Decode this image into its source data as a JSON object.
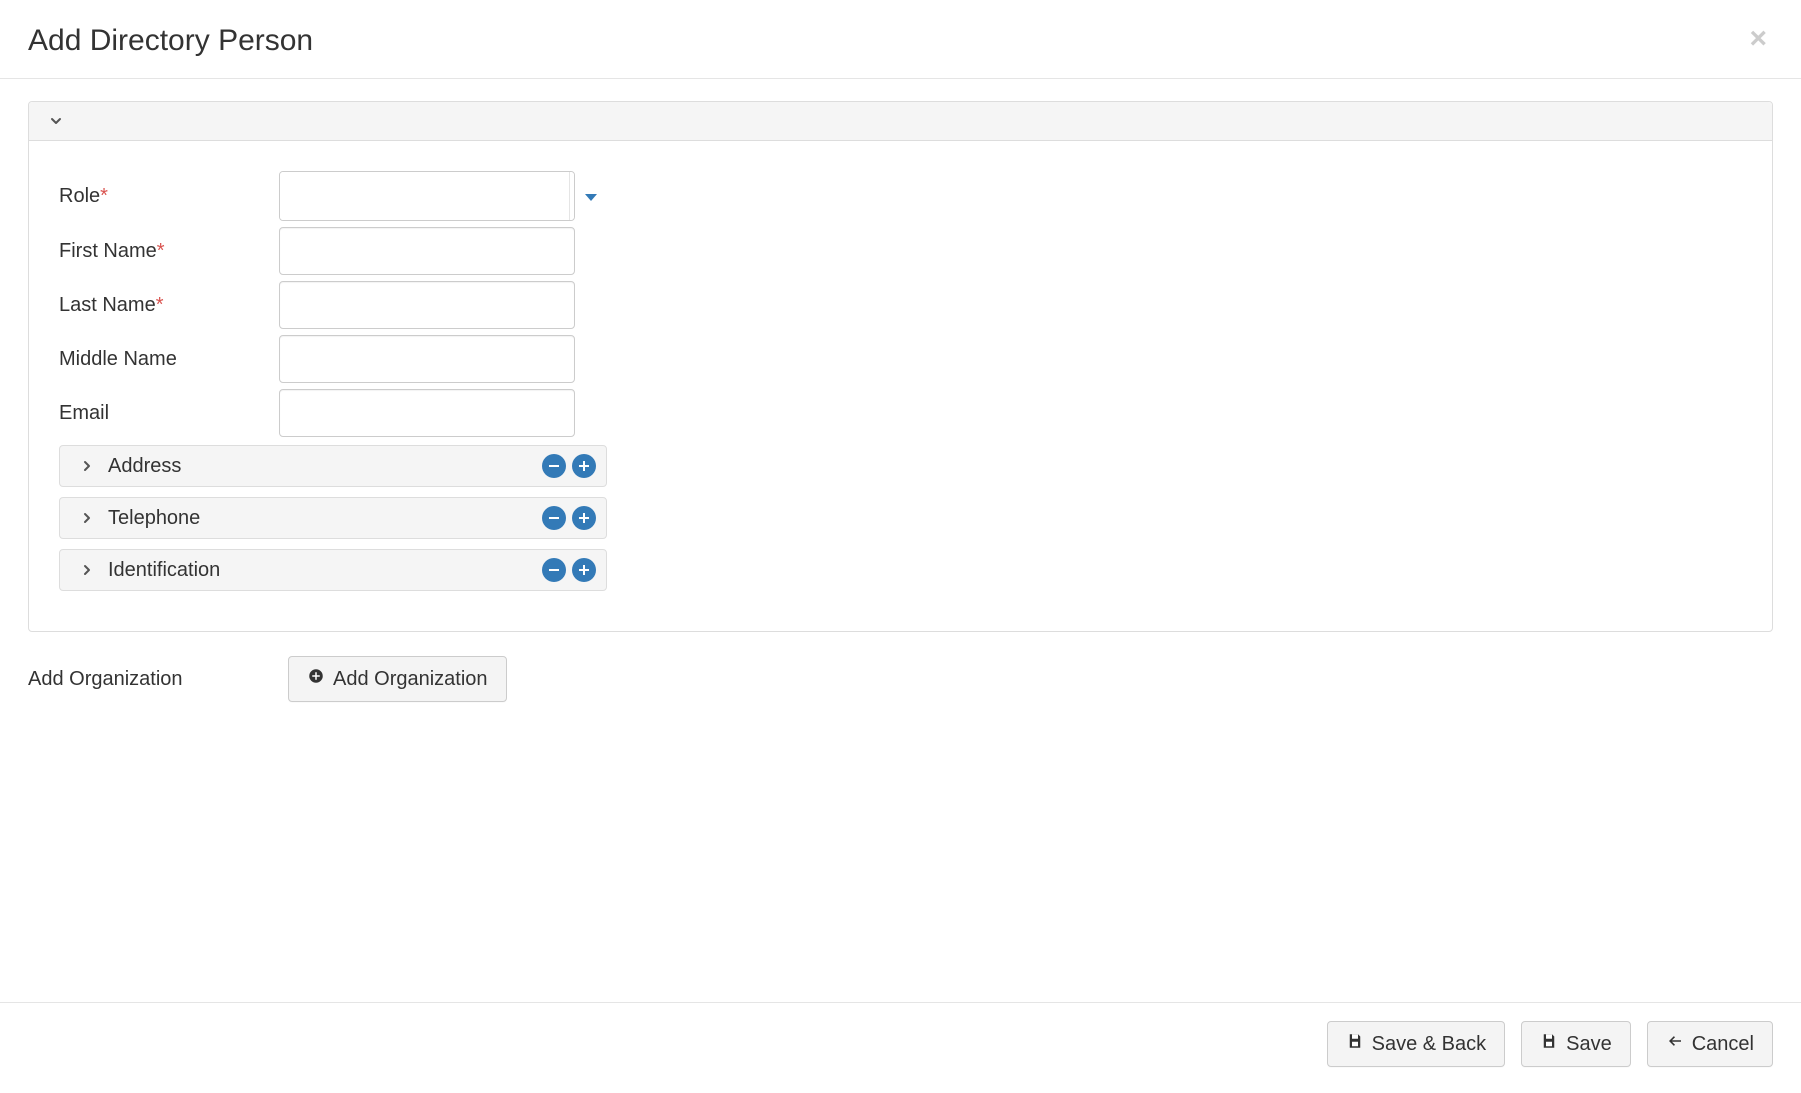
{
  "title": "Add Directory Person",
  "fields": {
    "role": {
      "label": "Role",
      "required": true,
      "value": ""
    },
    "first_name": {
      "label": "First Name",
      "required": true,
      "value": ""
    },
    "last_name": {
      "label": "Last Name",
      "required": true,
      "value": ""
    },
    "middle_name": {
      "label": "Middle Name",
      "required": false,
      "value": ""
    },
    "email": {
      "label": "Email",
      "required": false,
      "value": ""
    }
  },
  "sub_panels": [
    {
      "label": "Address"
    },
    {
      "label": "Telephone"
    },
    {
      "label": "Identification"
    }
  ],
  "add_org": {
    "label": "Add Organization",
    "button": "Add Organization"
  },
  "footer": {
    "save_back": "Save & Back",
    "save": "Save",
    "cancel": "Cancel"
  }
}
